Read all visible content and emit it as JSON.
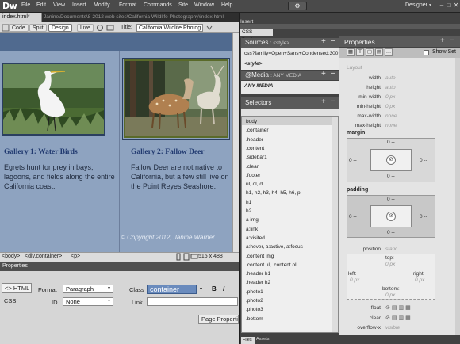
{
  "app": {
    "logo": "Dw",
    "menus": [
      "File",
      "Edit",
      "View",
      "Insert",
      "Modify",
      "Format",
      "Commands",
      "Site",
      "Window",
      "Help"
    ],
    "workspace": "Designer",
    "workspace_caret": "▾",
    "gear_icon": "⚙",
    "window_buttons": [
      "–",
      "□",
      "✕"
    ]
  },
  "document": {
    "tab_label": "index.html*",
    "path": "Janine\\Documents\\8-2012 web sites\\California Wildlife Photography\\index.html",
    "view_buttons": [
      "Code",
      "Split",
      "Design",
      "Live"
    ],
    "active_view": "Design",
    "title_label": "Title:",
    "title_value": "California Wildlife Photog"
  },
  "gallery": {
    "cards": [
      {
        "title": "Gallery 1: Water Birds",
        "text": "Egrets hunt for prey in bays, lagoons, and fields along the entire California coast."
      },
      {
        "title": "Gallery 2: Fallow Deer",
        "text": "Fallow Deer are not native to California, but a few still live on the Point Reyes Seashore."
      }
    ],
    "copyright": "© Copyright 2012, Janine Warner"
  },
  "statusbar": {
    "tags": [
      "<body>",
      "<div.container>",
      "<p>"
    ],
    "dimensions": "515 x 488"
  },
  "properties": {
    "title": "Properties",
    "html_button": "<> HTML",
    "css_button": "CSS",
    "format_label": "Format",
    "format_value": "Paragraph",
    "id_label": "ID",
    "id_value": "None",
    "class_label": "Class",
    "class_value": "container",
    "link_label": "Link",
    "bold": "B",
    "italic": "I",
    "page_properties": "Page Properties..."
  },
  "dock": {
    "insert_tab": "Insert",
    "css_designer_tab": "CSS Designer",
    "sources": {
      "label": "Sources",
      "sub": ": <style>",
      "items": [
        "css?family=Open+Sans+Condensed:300",
        "<style>"
      ]
    },
    "media": {
      "label": "@Media",
      "sub": ": ANY MEDIA",
      "items": [
        "ANY MEDIA"
      ]
    },
    "selectors": {
      "label": "Selectors",
      "items": [
        "body",
        ".container",
        ".header",
        ".content",
        ".sidebar1",
        ".clear",
        ".footer",
        "ul, ol, dl",
        "h1, h2, h3, h4, h5, h6, p",
        "h1",
        "h2",
        "a img",
        "a:link",
        "a:visited",
        "a:hover, a:active, a:focus",
        ".content img",
        ".content ul, .content ol",
        ".header h1",
        ".header h2",
        ".photo1",
        ".photo2",
        ".photo3",
        ".bottom"
      ]
    },
    "css_properties": {
      "title": "Properties",
      "show_set": "Show Set",
      "layout_label": "Layout",
      "rows": [
        {
          "label": "width",
          "value": "auto"
        },
        {
          "label": "height",
          "value": "auto"
        },
        {
          "label": "min-width",
          "value": "0 px"
        },
        {
          "label": "min-height",
          "value": "0 px"
        },
        {
          "label": "max-width",
          "value": "none"
        },
        {
          "label": "max-height",
          "value": "none"
        }
      ],
      "margin_label": "margin",
      "padding_label": "padding",
      "margin_values": {
        "top": "0 --",
        "left": "0 --",
        "right": "0 --",
        "bottom": "0 --"
      },
      "padding_values": {
        "top": "0 --",
        "left": "0 --",
        "right": "0 --",
        "bottom": "0 --"
      },
      "position_label": "position",
      "position_value": "static",
      "offset": {
        "top": "top:",
        "left": "left:",
        "right": "right:",
        "bottom": "bottom:",
        "top_val": "0 px",
        "left_val": "0 px",
        "right_val": "0 px",
        "bottom_val": "0 px"
      },
      "float_label": "float",
      "clear_label": "clear",
      "overflow_label": "overflow-x",
      "overflow_value": "visible"
    },
    "bottom_tabs": [
      "Files",
      "Assets"
    ]
  },
  "colors": {
    "accent_class": "#6a8bbd",
    "card_title": "#213a70",
    "design_bg": "#8ea3c0"
  }
}
